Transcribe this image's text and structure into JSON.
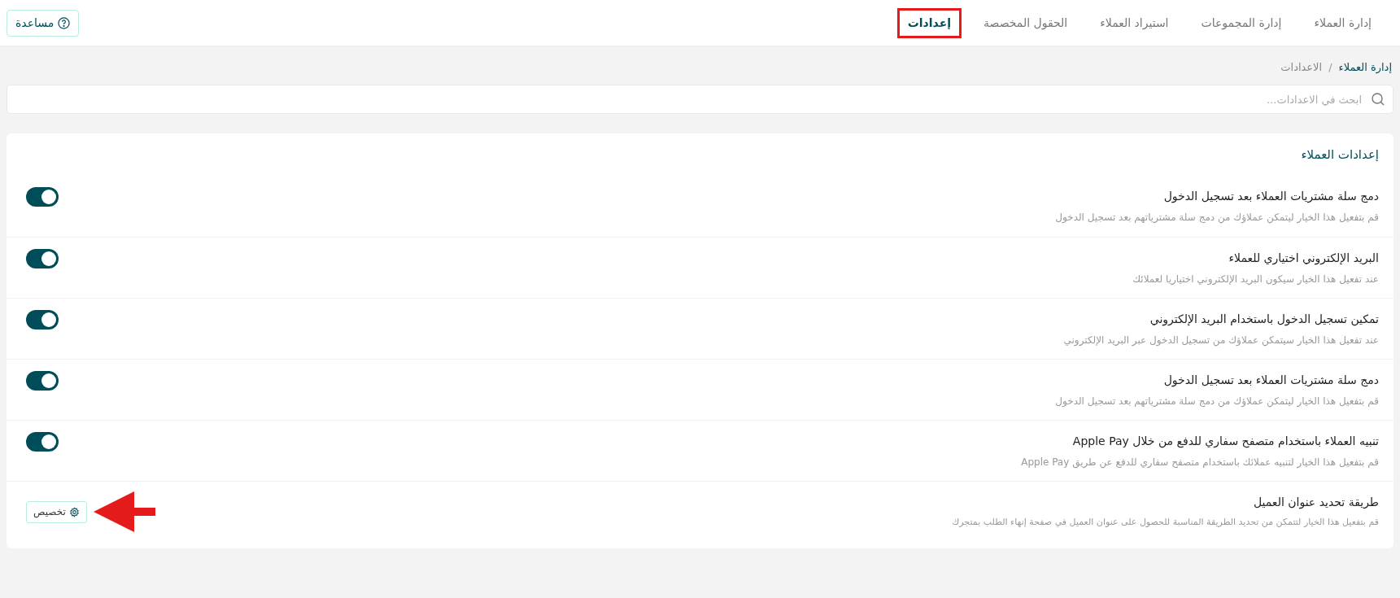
{
  "header": {
    "tabs": [
      {
        "label": "إدارة العملاء",
        "selected": false,
        "highlighted": false
      },
      {
        "label": "إدارة المجموعات",
        "selected": false,
        "highlighted": false
      },
      {
        "label": "استيراد العملاء",
        "selected": false,
        "highlighted": false
      },
      {
        "label": "الحقول المخصصة",
        "selected": false,
        "highlighted": false
      },
      {
        "label": "إعدادات",
        "selected": true,
        "highlighted": true
      }
    ],
    "help_button": "مساعدة"
  },
  "breadcrumb": [
    "إدارة العملاء",
    "الاعدادات"
  ],
  "breadcrumb_separator": "/",
  "search": {
    "placeholder": "ابحث في الاعدادات..."
  },
  "card": {
    "title": "إعدادات العملاء",
    "rows": [
      {
        "kind": "toggle",
        "title": "دمج سلة مشتريات العملاء بعد تسجيل الدخول",
        "description": "قم بتفعيل هذا الخيار ليتمكن عملاؤك من دمج سلة مشترياتهم بعد تسجيل الدخول",
        "on": true
      },
      {
        "kind": "toggle",
        "title": "البريد الإلكتروني اختياري للعملاء",
        "description": "عند تفعيل هذا الخيار سيكون البريد الإلكتروني اختياريا لعملائك",
        "on": true
      },
      {
        "kind": "toggle",
        "title": "تمكين تسجيل الدخول باستخدام البريد الإلكتروني",
        "description": "عند تفعيل هذا الخيار سيتمكن عملاؤك من تسجيل الدخول عبر البريد الإلكتروني",
        "on": true
      },
      {
        "kind": "toggle",
        "title": "دمج سلة مشتريات العملاء بعد تسجيل الدخول",
        "description": "قم بتفعيل هذا الخيار ليتمكن عملاؤك من دمج سلة مشترياتهم بعد تسجيل الدخول",
        "on": true
      },
      {
        "kind": "toggle",
        "title": "تنبيه العملاء باستخدام متصفح سفاري للدفع من خلال Apple Pay",
        "description": "قم بتفعيل هذا الخيار لتنبيه عملائك باستخدام متصفح سفاري للدفع عن طريق Apple Pay",
        "on": true
      },
      {
        "kind": "button",
        "title": "طريقة تحديد عنوان العميل",
        "description": "قم بتفعيل هذا الخيار لتتمكن من تحديد الطريقة المناسبة للحصول على عنوان العميل في صفحة إنهاء الطلب بمتجرك",
        "button": "تخصيص",
        "arrow_annotation": true
      }
    ]
  }
}
